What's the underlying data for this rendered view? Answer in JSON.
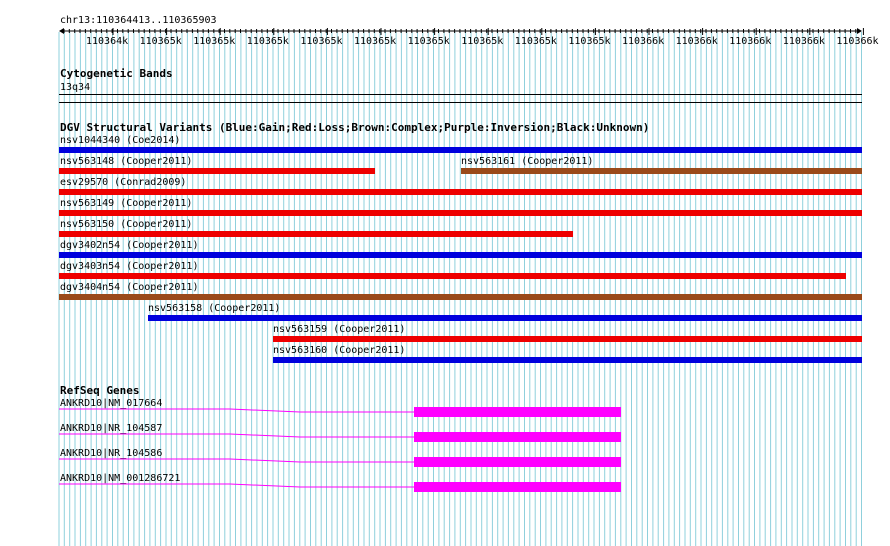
{
  "ruler": {
    "region": "chr13:110364413..110365903",
    "ticks": [
      "110364k",
      "110365k",
      "110365k",
      "110365k",
      "110365k",
      "110365k",
      "110365k",
      "110365k",
      "110365k",
      "110365k",
      "110366k",
      "110366k",
      "110366k",
      "110366k",
      "110366k",
      "110366k"
    ]
  },
  "cytobands": {
    "title": "Cytogenetic Bands",
    "band": "13q34"
  },
  "dgv": {
    "title": "DGV Structural Variants (Blue:Gain;Red:Loss;Brown:Complex;Purple:Inversion;Black:Unknown)",
    "features": [
      {
        "label": "nsv1044340 (Coe2014)",
        "type": "Gain",
        "color": "#0000dd"
      },
      {
        "label": "nsv563148 (Cooper2011)",
        "type": "Loss",
        "color": "#ee0000"
      },
      {
        "label": "nsv563161 (Cooper2011)",
        "type": "Complex",
        "color": "#9a4a1a"
      },
      {
        "label": "esv29570 (Conrad2009)",
        "type": "Loss",
        "color": "#ee0000"
      },
      {
        "label": "nsv563149 (Cooper2011)",
        "type": "Loss",
        "color": "#ee0000"
      },
      {
        "label": "nsv563150 (Cooper2011)",
        "type": "Loss",
        "color": "#ee0000"
      },
      {
        "label": "dgv3402n54 (Cooper2011)",
        "type": "Gain",
        "color": "#0000dd"
      },
      {
        "label": "dgv3403n54 (Cooper2011)",
        "type": "Loss",
        "color": "#ee0000"
      },
      {
        "label": "dgv3404n54 (Cooper2011)",
        "type": "Complex",
        "color": "#9a4a1a"
      },
      {
        "label": "nsv563158 (Cooper2011)",
        "type": "Gain",
        "color": "#0000dd"
      },
      {
        "label": "nsv563159 (Cooper2011)",
        "type": "Loss",
        "color": "#ee0000"
      },
      {
        "label": "nsv563160 (Cooper2011)",
        "type": "Gain",
        "color": "#0000dd"
      }
    ]
  },
  "refseq": {
    "title": "RefSeq Genes",
    "color": "#ff00ff",
    "genes": [
      {
        "label": "ANKRD10|NM_017664"
      },
      {
        "label": "ANKRD10|NR_104587"
      },
      {
        "label": "ANKRD10|NR_104586"
      },
      {
        "label": "ANKRD10|NM_001286721"
      }
    ]
  },
  "colors": {
    "gridline": "#8fd0dc",
    "gain": "#0000dd",
    "loss": "#ee0000",
    "complex": "#9a4a1a",
    "gene": "#ff00ff"
  }
}
